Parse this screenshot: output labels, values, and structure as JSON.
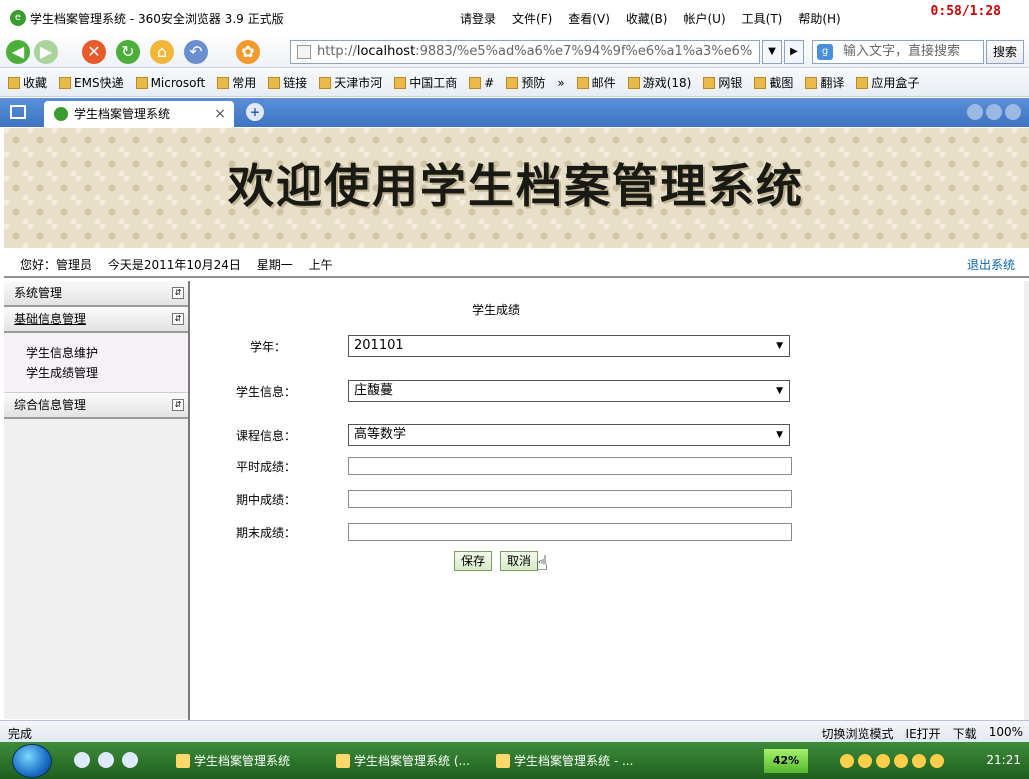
{
  "window": {
    "title": "学生档案管理系统 - 360安全浏览器 3.9 正式版",
    "menus": [
      "请登录",
      "文件(F)",
      "查看(V)",
      "收藏(B)",
      "帐户(U)",
      "工具(T)",
      "帮助(H)"
    ],
    "clock": "0:58/1:28"
  },
  "nav": {
    "address_prefix": "http://",
    "address_host": "localhost",
    "address_rest": ":9883/%e5%ad%a6%e7%94%9f%e6%a1%a3%e6%",
    "search_placeholder": "输入文字，直接搜索",
    "search_button": "搜索"
  },
  "bookmarks": [
    "收藏",
    "EMS快递",
    "Microsoft",
    "常用",
    "链接",
    "天津市河",
    "中国工商",
    "#",
    "预防",
    "»",
    "邮件",
    "游戏(18)",
    "网银",
    "截图",
    "翻译",
    "应用盒子"
  ],
  "tab": {
    "label": "学生档案管理系统",
    "close": "×",
    "new": "+"
  },
  "banner": {
    "title": "欢迎使用学生档案管理系统"
  },
  "info": {
    "greeting": "您好：管理员",
    "date": "今天是2011年10月24日",
    "weekday": "星期一",
    "ampm": "上午",
    "logout": "退出系统"
  },
  "sidebar": {
    "system": "系统管理",
    "basic": "基础信息管理",
    "sub_items": [
      "学生信息维护",
      "学生成绩管理"
    ],
    "comprehensive": "综合信息管理"
  },
  "form": {
    "title": "学生成绩",
    "year_label": "学年：",
    "year_value": "201101",
    "student_label": "学生信息：",
    "student_value": "庄馥蔓",
    "course_label": "课程信息：",
    "course_value": "高等数学",
    "usual_label": "平时成绩：",
    "mid_label": "期中成绩：",
    "final_label": "期末成绩：",
    "save": "保存",
    "cancel": "取消"
  },
  "status": {
    "left": "完成",
    "switch_mode": "切换浏览模式",
    "ie_open": "IE打开",
    "download": "下载",
    "zoom": "100%"
  },
  "taskbar": {
    "tasks": [
      "学生档案管理系统",
      "学生档案管理系统 (...",
      "学生档案管理系统 - ..."
    ],
    "battery": "42%",
    "time": "21:21"
  }
}
